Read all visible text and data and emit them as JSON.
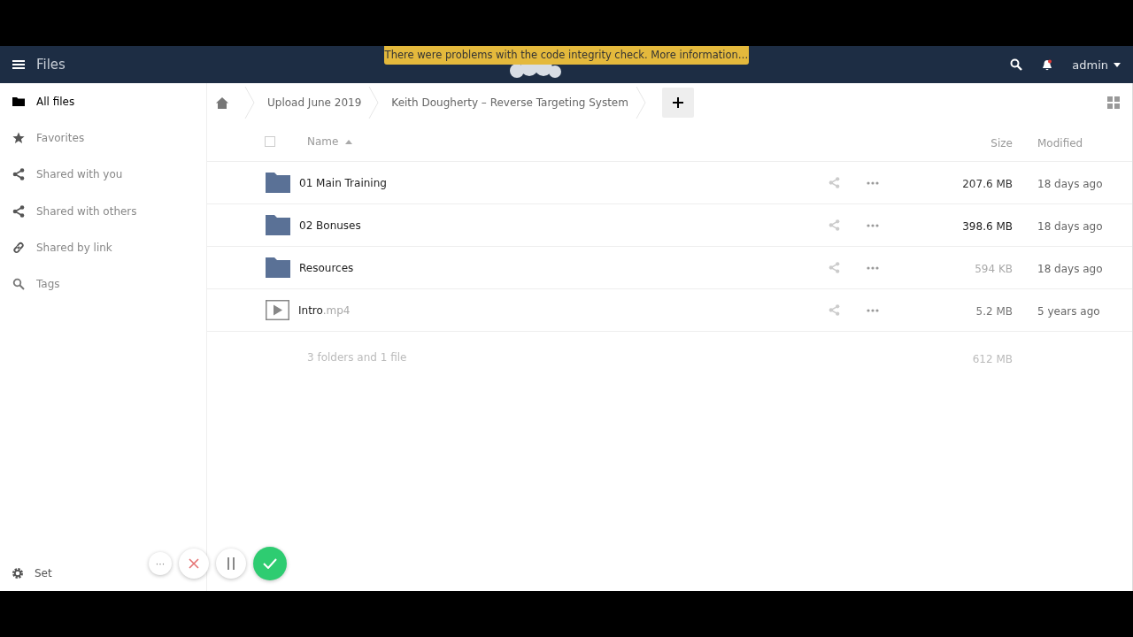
{
  "header": {
    "title": "Files",
    "notice": "There were problems with the code integrity check. More information…",
    "user": "admin",
    "notification_unread": true
  },
  "sidebar": {
    "items": [
      {
        "label": "All files",
        "selected": true
      },
      {
        "label": "Favorites",
        "selected": false
      },
      {
        "label": "Shared with you",
        "selected": false
      },
      {
        "label": "Shared with others",
        "selected": false
      },
      {
        "label": "Shared by link",
        "selected": false
      },
      {
        "label": "Tags",
        "selected": false
      }
    ],
    "settings": "Set"
  },
  "breadcrumbs": [
    "Upload June 2019",
    "Keith Dougherty – Reverse Targeting System"
  ],
  "table": {
    "select_all_checked": false,
    "columns": [
      "Name",
      "Size",
      "Modified"
    ],
    "rows": [
      {
        "kind": "folder",
        "name": "01 Main Training",
        "size": {
          "text": "207.6 MB",
          "color": "#333333"
        },
        "modified": "18 days ago"
      },
      {
        "kind": "folder",
        "name": "02 Bonuses",
        "size": {
          "text": "398.6 MB",
          "color": "#222222"
        },
        "modified": "18 days ago"
      },
      {
        "kind": "folder",
        "name": "Resources",
        "size": {
          "text": "594 KB",
          "color": "#aaaaaa"
        },
        "modified": "18 days ago"
      },
      {
        "kind": "video",
        "name": "Intro",
        "extension": ".mp4",
        "size": {
          "text": "5.2 MB",
          "color": "#777777"
        },
        "modified": "5 years ago"
      }
    ],
    "summary": "3 folders and 1 file",
    "total": "612 MB"
  },
  "recorder": {
    "more": "···"
  }
}
